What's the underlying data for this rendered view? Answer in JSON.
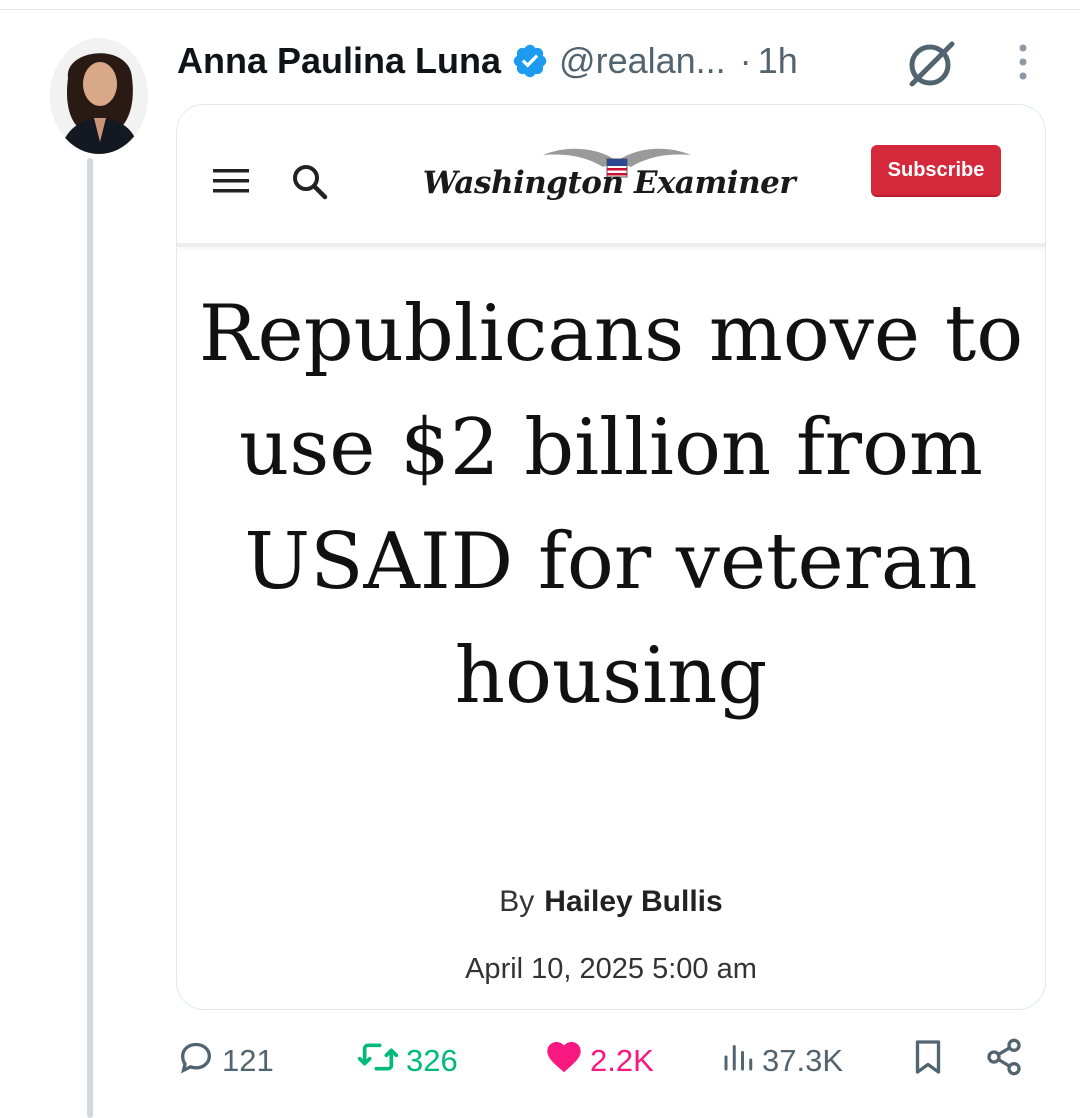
{
  "tweet": {
    "author_name": "Anna Paulina Luna",
    "handle": "@realan...",
    "separator": "·",
    "time": "1h"
  },
  "article": {
    "site_name": "Washington Examiner",
    "subscribe_label": "Subscribe",
    "headline": "Republicans move to use $2 billion from USAID for veteran housing",
    "by_label": "By",
    "author": "Hailey Bullis",
    "date": "April 10, 2025 5:00 am"
  },
  "actions": {
    "replies": "121",
    "retweets": "326",
    "likes": "2.2K",
    "views": "37.3K"
  },
  "colors": {
    "verified": "#1d9bf0",
    "retweet_active": "#00ba7c",
    "like_active": "#f91880",
    "subscribe": "#d4293b"
  },
  "icons": [
    "verified-badge-icon",
    "grok-icon",
    "more-icon",
    "menu-icon",
    "search-icon",
    "eagle-logo-icon",
    "reply-icon",
    "retweet-icon",
    "heart-icon",
    "views-icon",
    "bookmark-icon",
    "share-icon"
  ]
}
